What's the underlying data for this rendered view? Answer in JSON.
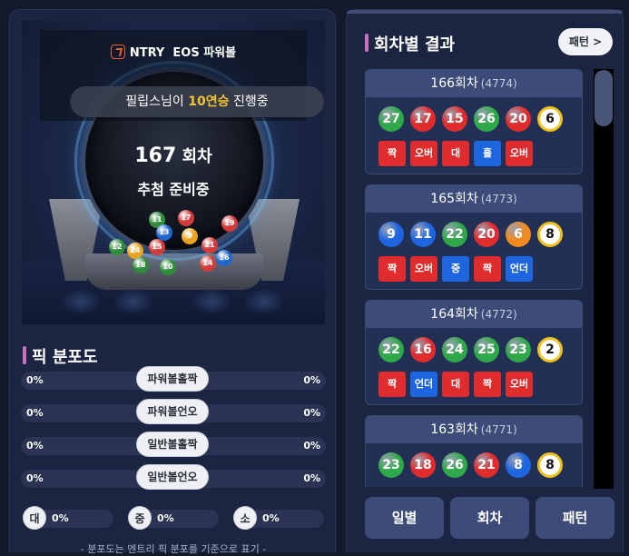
{
  "brand": {
    "logo_text": "NTRY",
    "title": "EOS 파워볼"
  },
  "streak": {
    "prefix": "필립스님이 ",
    "count": "10연승",
    "suffix": " 진행중"
  },
  "current": {
    "round_number": "167",
    "round_unit": " 회차",
    "status": "추첨 준비중"
  },
  "globe_balls": [
    {
      "num": "11",
      "color": "#2f8d3a"
    },
    {
      "num": "17",
      "color": "#d23b3b"
    },
    {
      "num": "19",
      "color": "#d23b3b"
    },
    {
      "num": "13",
      "color": "#1e66d0"
    },
    {
      "num": "9",
      "color": "#e8a21e"
    },
    {
      "num": "15",
      "color": "#d23b3b"
    },
    {
      "num": "12",
      "color": "#2f8d3a"
    },
    {
      "num": "24",
      "color": "#e8a21e"
    },
    {
      "num": "21",
      "color": "#d23b3b"
    },
    {
      "num": "18",
      "color": "#2f8d3a"
    },
    {
      "num": "10",
      "color": "#2f8d3a"
    },
    {
      "num": "16",
      "color": "#1e66d0"
    },
    {
      "num": "14",
      "color": "#d23b3b"
    }
  ],
  "distribution": {
    "title": "픽 분포도",
    "rows": [
      {
        "label": "파워볼홀짝",
        "left": "0%",
        "right": "0%"
      },
      {
        "label": "파워볼언오",
        "left": "0%",
        "right": "0%"
      },
      {
        "label": "일반볼홀짝",
        "left": "0%",
        "right": "0%"
      },
      {
        "label": "일반볼언오",
        "left": "0%",
        "right": "0%"
      }
    ],
    "mini": [
      {
        "label": "대",
        "value": "0%"
      },
      {
        "label": "중",
        "value": "0%"
      },
      {
        "label": "소",
        "value": "0%"
      }
    ],
    "note": "- 분포도는 엔트리 픽 분포를 기준으로 표기 -"
  },
  "results": {
    "title": "회차별 결과",
    "pattern_button": "패턴 >",
    "rounds": [
      {
        "round": "166회차",
        "sub": "(4774)",
        "balls": [
          {
            "num": "27",
            "color": "#2fa84a"
          },
          {
            "num": "17",
            "color": "#e02c2c"
          },
          {
            "num": "15",
            "color": "#e02c2c"
          },
          {
            "num": "26",
            "color": "#2fa84a"
          },
          {
            "num": "20",
            "color": "#e02c2c"
          }
        ],
        "powerball": "6",
        "tags": [
          {
            "text": "짝",
            "color": "#e02c2c"
          },
          {
            "text": "오버",
            "color": "#e02c2c"
          },
          {
            "text": "대",
            "color": "#e02c2c"
          },
          {
            "text": "홀",
            "color": "#1e66e0"
          },
          {
            "text": "오버",
            "color": "#e02c2c"
          }
        ]
      },
      {
        "round": "165회차",
        "sub": "(4773)",
        "balls": [
          {
            "num": "9",
            "color": "#1e66e0"
          },
          {
            "num": "11",
            "color": "#1e66e0"
          },
          {
            "num": "22",
            "color": "#2fa84a"
          },
          {
            "num": "20",
            "color": "#e02c2c"
          },
          {
            "num": "6",
            "color": "#f08a1e"
          }
        ],
        "powerball": "8",
        "tags": [
          {
            "text": "짝",
            "color": "#e02c2c"
          },
          {
            "text": "오버",
            "color": "#e02c2c"
          },
          {
            "text": "중",
            "color": "#1e66e0"
          },
          {
            "text": "짝",
            "color": "#e02c2c"
          },
          {
            "text": "언더",
            "color": "#1e66e0"
          }
        ]
      },
      {
        "round": "164회차",
        "sub": "(4772)",
        "balls": [
          {
            "num": "22",
            "color": "#2fa84a"
          },
          {
            "num": "16",
            "color": "#e02c2c"
          },
          {
            "num": "24",
            "color": "#2fa84a"
          },
          {
            "num": "25",
            "color": "#2fa84a"
          },
          {
            "num": "23",
            "color": "#2fa84a"
          }
        ],
        "powerball": "2",
        "tags": [
          {
            "text": "짝",
            "color": "#e02c2c"
          },
          {
            "text": "언더",
            "color": "#1e66e0"
          },
          {
            "text": "대",
            "color": "#e02c2c"
          },
          {
            "text": "짝",
            "color": "#e02c2c"
          },
          {
            "text": "오버",
            "color": "#e02c2c"
          }
        ]
      },
      {
        "round": "163회차",
        "sub": "(4771)",
        "balls": [
          {
            "num": "23",
            "color": "#2fa84a"
          },
          {
            "num": "18",
            "color": "#e02c2c"
          },
          {
            "num": "26",
            "color": "#2fa84a"
          },
          {
            "num": "21",
            "color": "#e02c2c"
          },
          {
            "num": "8",
            "color": "#1e66e0"
          }
        ],
        "powerball": "8",
        "tags": []
      }
    ]
  },
  "bottom_buttons": [
    "일별",
    "회차",
    "패턴"
  ]
}
